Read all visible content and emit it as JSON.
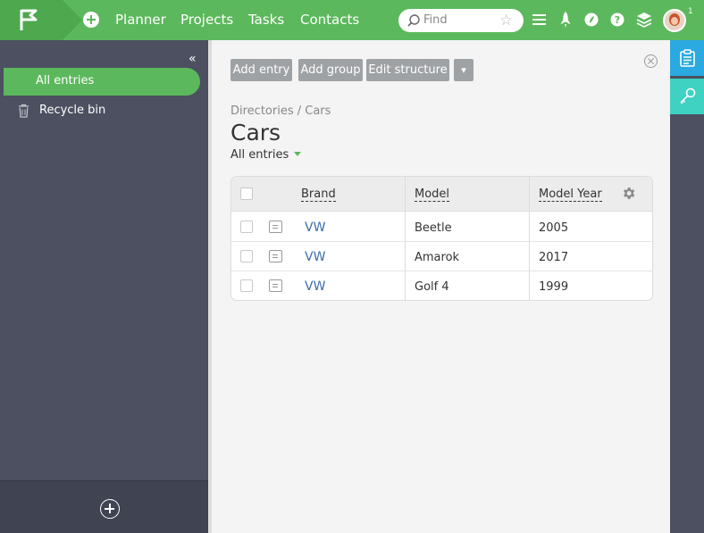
{
  "topbar": {
    "nav": [
      "Planner",
      "Projects",
      "Tasks",
      "Contacts"
    ],
    "search_placeholder": "Find",
    "notification_count": "1",
    "icons": [
      "menu-icon",
      "rocket-icon",
      "leaf-icon",
      "help-icon",
      "layers-icon"
    ]
  },
  "sidebar": {
    "items": [
      {
        "label": "All entries",
        "active": true
      },
      {
        "label": "Recycle bin",
        "icon": "trash-icon"
      }
    ]
  },
  "toolbar": {
    "add_entry": "Add entry",
    "add_group": "Add group",
    "edit_structure": "Edit structure",
    "more": "▾"
  },
  "page": {
    "breadcrumb": "Directories / Cars",
    "title": "Cars",
    "view": "All entries"
  },
  "table": {
    "columns": [
      "Brand",
      "Model",
      "Model Year"
    ],
    "rows": [
      {
        "brand": "VW",
        "model": "Beetle",
        "year": "2005"
      },
      {
        "brand": "VW",
        "model": "Amarok",
        "year": "2017"
      },
      {
        "brand": "VW",
        "model": "Golf 4",
        "year": "1999"
      }
    ]
  },
  "colors": {
    "accent": "#5cb85c",
    "sidebar": "#4c5061",
    "link": "#3b6ea8",
    "rail_blue": "#2ba9e1",
    "rail_teal": "#3fd1c2"
  }
}
